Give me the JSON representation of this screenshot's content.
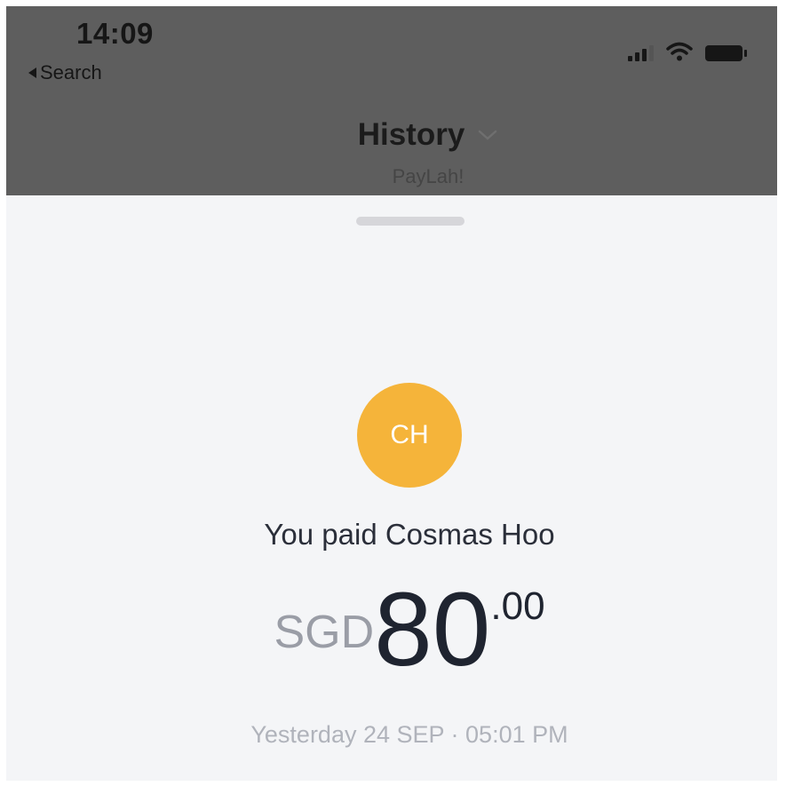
{
  "status_bar": {
    "time": "14:09",
    "back_label": "Search"
  },
  "nav": {
    "title": "History",
    "subtitle": "PayLah!"
  },
  "transaction": {
    "avatar_initials": "CH",
    "avatar_color": "#f5b43a",
    "description": "You paid Cosmas Hoo",
    "currency": "SGD",
    "amount_whole": "80",
    "amount_cents": ".00",
    "timestamp": "Yesterday 24 SEP · 05:01 PM"
  }
}
